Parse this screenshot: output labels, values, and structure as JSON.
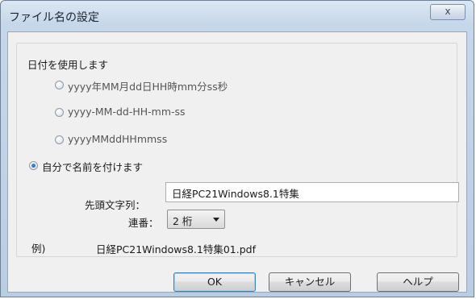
{
  "window": {
    "title": "ファイル名の設定",
    "close_glyph": "ⅹ"
  },
  "date_section": {
    "label": "日付を使用します",
    "options": [
      {
        "label": "yyyy年MM月dd日HH時mm分ss秒",
        "checked": false
      },
      {
        "label": "yyyy-MM-dd-HH-mm-ss",
        "checked": false
      },
      {
        "label": "yyyyMMddHHmmss",
        "checked": false
      }
    ]
  },
  "custom_section": {
    "label": "自分で名前を付けます",
    "checked": true,
    "prefix_label": "先頭文字列：",
    "prefix_value": "日経PC21Windows8.1特集",
    "serial_label": "連番：",
    "serial_value": "2 桁"
  },
  "example": {
    "label": "例)",
    "value": "日経PC21Windows8.1特集01.pdf"
  },
  "buttons": {
    "ok": "OK",
    "cancel": "キャンセル",
    "help": "ヘルプ"
  }
}
